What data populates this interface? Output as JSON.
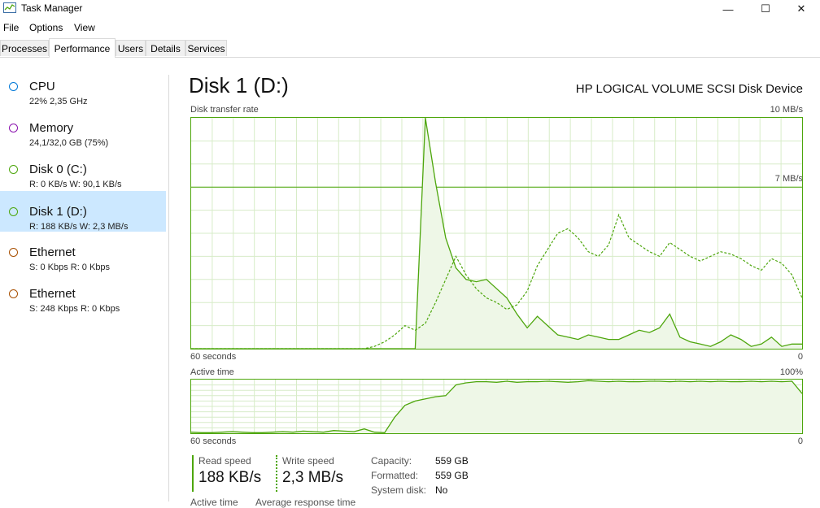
{
  "window": {
    "title": "Task Manager",
    "minimize_glyph": "—",
    "maximize_glyph": "☐",
    "close_glyph": "✕"
  },
  "menu": {
    "file": "File",
    "options": "Options",
    "view": "View"
  },
  "tabs": [
    "Processes",
    "Performance",
    "Users",
    "Details",
    "Services"
  ],
  "sidebar": {
    "items": [
      {
        "title": "CPU",
        "sub": "22%  2,35 GHz",
        "color": "#0078d7"
      },
      {
        "title": "Memory",
        "sub": "24,1/32,0 GB (75%)",
        "color": "#8b12ae"
      },
      {
        "title": "Disk 0 (C:)",
        "sub": "R: 0 KB/s  W: 90,1 KB/s",
        "color": "#4da60c"
      },
      {
        "title": "Disk 1 (D:)",
        "sub": "R: 188 KB/s  W: 2,3 MB/s",
        "color": "#4da60c"
      },
      {
        "title": "Ethernet",
        "sub": "S: 0 Kbps  R: 0 Kbps",
        "color": "#a74f01"
      },
      {
        "title": "Ethernet",
        "sub": "S: 248 Kbps  R: 0 Kbps",
        "color": "#a74f01"
      }
    ]
  },
  "main": {
    "title": "Disk 1 (D:)",
    "device": "HP LOGICAL VOLUME SCSI Disk Device",
    "transfer": {
      "label": "Disk transfer rate",
      "max_label": "10 MB/s",
      "mid_label": "7 MB/s",
      "time_label": "60 seconds",
      "zero_label": "0"
    },
    "active": {
      "label": "Active time",
      "max_label": "100%",
      "time_label": "60 seconds",
      "zero_label": "0"
    },
    "stats": {
      "read_label": "Read speed",
      "read_value": "188 KB/s",
      "write_label": "Write speed",
      "write_value": "2,3 MB/s"
    },
    "props": [
      {
        "label": "Capacity:",
        "value": "559 GB"
      },
      {
        "label": "Formatted:",
        "value": "559 GB"
      },
      {
        "label": "System disk:",
        "value": "No"
      }
    ],
    "cut_labels": {
      "active_time": "Active time",
      "avg_response": "Average response time"
    }
  },
  "colors": {
    "accent_green": "#4da60c",
    "grid_green": "#d7ecc8",
    "fill_green": "#eef7e7",
    "selection": "#cce8ff"
  },
  "chart_data": [
    {
      "type": "line",
      "title": "Disk transfer rate",
      "ylim": [
        0,
        10
      ],
      "y_unit": "MB/s",
      "x_range_label": "60 seconds",
      "x": [
        0,
        1,
        2,
        3,
        4,
        5,
        6,
        7,
        8,
        9,
        10,
        11,
        12,
        13,
        14,
        15,
        16,
        17,
        18,
        19,
        20,
        21,
        22,
        23,
        24,
        25,
        26,
        27,
        28,
        29,
        30,
        31,
        32,
        33,
        34,
        35,
        36,
        37,
        38,
        39,
        40,
        41,
        42,
        43,
        44,
        45,
        46,
        47,
        48,
        49,
        50,
        51,
        52,
        53,
        54,
        55,
        56,
        57,
        58,
        59,
        60
      ],
      "series": [
        {
          "style": "solid-filled",
          "values": [
            0,
            0,
            0,
            0,
            0,
            0,
            0,
            0,
            0,
            0,
            0,
            0,
            0,
            0,
            0,
            0,
            0,
            0,
            0,
            0,
            0,
            0,
            0,
            10,
            7.2,
            4.8,
            3.5,
            3.0,
            2.9,
            3.0,
            2.6,
            2.2,
            1.5,
            0.9,
            1.4,
            1.0,
            0.6,
            0.5,
            0.4,
            0.6,
            0.5,
            0.4,
            0.4,
            0.6,
            0.8,
            0.7,
            0.9,
            1.5,
            0.5,
            0.3,
            0.2,
            0.1,
            0.3,
            0.6,
            0.4,
            0.1,
            0.2,
            0.5,
            0.1,
            0.2,
            0.2
          ]
        },
        {
          "style": "dashed",
          "values": [
            0,
            0,
            0,
            0,
            0,
            0,
            0,
            0,
            0,
            0,
            0,
            0,
            0,
            0,
            0,
            0,
            0,
            0,
            0.1,
            0.3,
            0.6,
            1.0,
            0.8,
            1.1,
            2.0,
            3.0,
            4.0,
            3.2,
            2.6,
            2.2,
            2.0,
            1.7,
            1.9,
            2.5,
            3.6,
            4.3,
            5.0,
            5.2,
            4.8,
            4.2,
            4.0,
            4.5,
            5.8,
            4.8,
            4.5,
            4.2,
            4.0,
            4.6,
            4.3,
            4.0,
            3.8,
            4.0,
            4.2,
            4.1,
            3.9,
            3.6,
            3.4,
            3.9,
            3.7,
            3.2,
            2.2
          ]
        }
      ]
    },
    {
      "type": "area",
      "title": "Active time",
      "ylim": [
        0,
        100
      ],
      "y_unit": "%",
      "x_range_label": "60 seconds",
      "x": [
        0,
        1,
        2,
        3,
        4,
        5,
        6,
        7,
        8,
        9,
        10,
        11,
        12,
        13,
        14,
        15,
        16,
        17,
        18,
        19,
        20,
        21,
        22,
        23,
        24,
        25,
        26,
        27,
        28,
        29,
        30,
        31,
        32,
        33,
        34,
        35,
        36,
        37,
        38,
        39,
        40,
        41,
        42,
        43,
        44,
        45,
        46,
        47,
        48,
        49,
        50,
        51,
        52,
        53,
        54,
        55,
        56,
        57,
        58,
        59,
        60
      ],
      "values": [
        2,
        1,
        1,
        2,
        3,
        2,
        1,
        1,
        2,
        3,
        2,
        4,
        3,
        2,
        5,
        4,
        3,
        8,
        2,
        1,
        30,
        52,
        60,
        64,
        68,
        70,
        90,
        94,
        96,
        96,
        95,
        97,
        95,
        96,
        96,
        97,
        96,
        95,
        96,
        98,
        97,
        96,
        97,
        96,
        96,
        97,
        97,
        96,
        97,
        96,
        97,
        96,
        97,
        96,
        96,
        97,
        96,
        97,
        96,
        97,
        74
      ]
    }
  ]
}
